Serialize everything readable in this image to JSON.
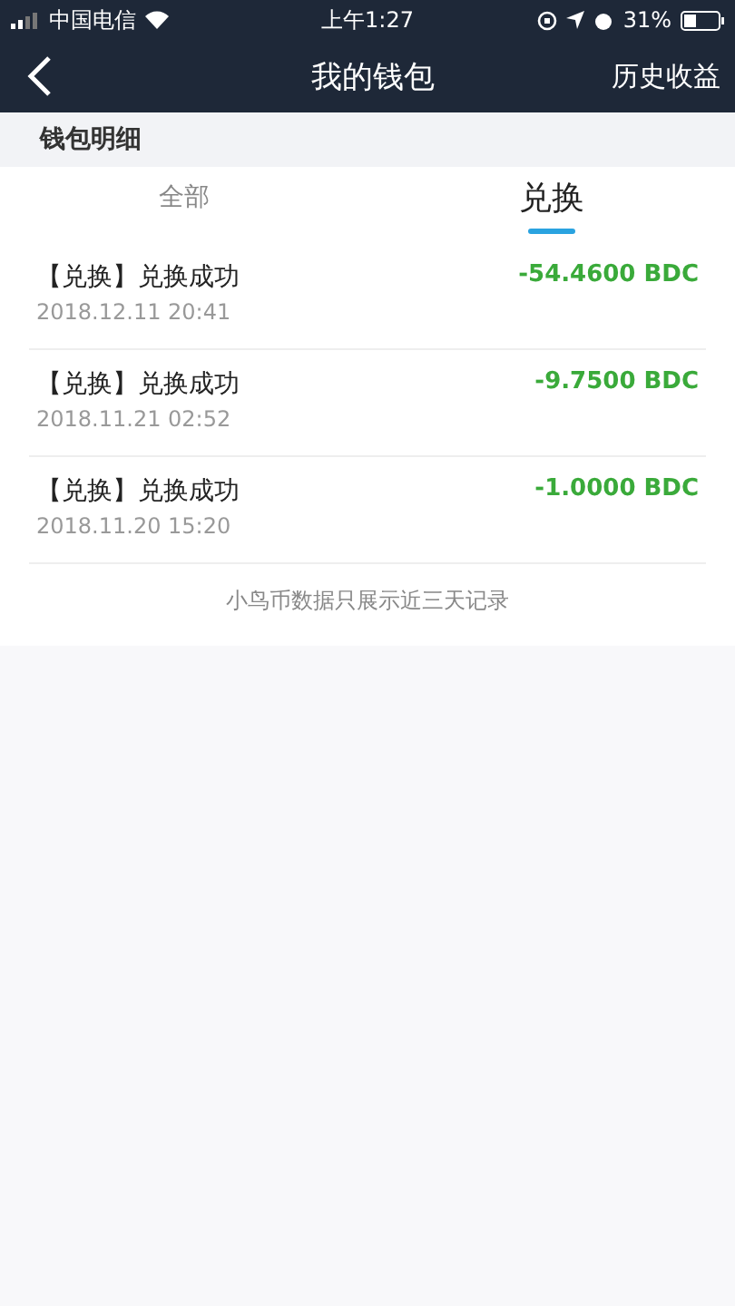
{
  "status_bar": {
    "carrier": "中国电信",
    "time": "上午1:27",
    "battery": "31%"
  },
  "nav": {
    "title": "我的钱包",
    "action": "历史收益"
  },
  "section_title": "钱包明细",
  "tabs": [
    {
      "label": "全部",
      "selected": false
    },
    {
      "label": "兑换",
      "selected": true
    }
  ],
  "records": [
    {
      "title": "【兑换】兑换成功",
      "date": "2018.12.11 20:41",
      "amount": "-54.4600 BDC"
    },
    {
      "title": "【兑换】兑换成功",
      "date": "2018.11.21 02:52",
      "amount": "-9.7500 BDC"
    },
    {
      "title": "【兑换】兑换成功",
      "date": "2018.11.20 15:20",
      "amount": "-1.0000 BDC"
    }
  ],
  "footer_note": "小鸟币数据只展示近三天记录"
}
